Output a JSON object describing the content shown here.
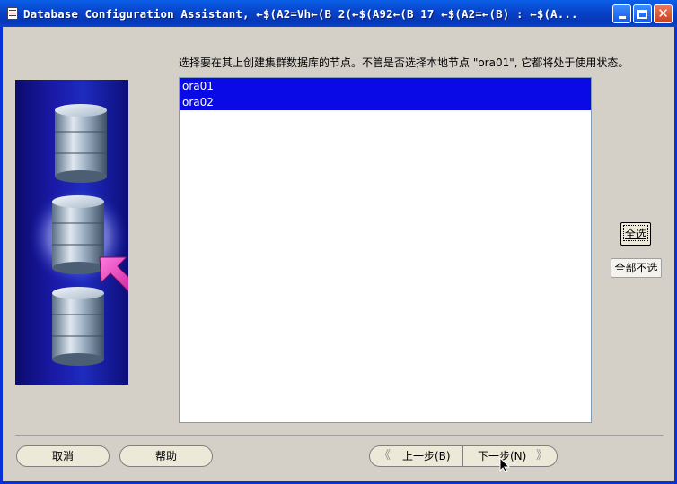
{
  "window": {
    "title": "Database Configuration Assistant, ←$(A2=Vh←(B 2(←$(A92←(B 17 ←$(A2=←(B) : ←$(A..."
  },
  "main": {
    "instruction": "选择要在其上创建集群数据库的节点。不管是否选择本地节点 \"ora01\", 它都将处于使用状态。",
    "nodes": [
      "ora01",
      "ora02"
    ],
    "select_all_label": "全选",
    "deselect_all_label": "全部不选"
  },
  "footer": {
    "cancel_label": "取消",
    "help_label": "帮助",
    "back_label": "上一步(B)",
    "next_label": "下一步(N)",
    "back_arrow": "《",
    "next_arrow": "》"
  },
  "colors": {
    "title_bar": "#0843c9",
    "selection": "#0a0ae6",
    "pointer_arrow": "#e81fb8"
  }
}
